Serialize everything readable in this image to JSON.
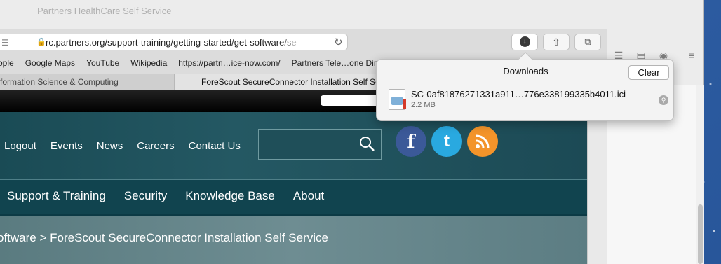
{
  "back_window": {
    "title": "Partners HealthCare Self Service"
  },
  "address_bar": {
    "url": "rc.partners.org/support-training/getting-started/get-software/se"
  },
  "bookmarks": [
    "ople",
    "Google Maps",
    "YouTube",
    "Wikipedia",
    "https://partn…ice-now.com/",
    "Partners Tele…one Direct"
  ],
  "tabs": [
    {
      "label": "formation Science & Computing"
    },
    {
      "label": "ForeScout SecureConnector Installation Self Se"
    }
  ],
  "header_nav": [
    "Logout",
    "Events",
    "News",
    "Careers",
    "Contact Us"
  ],
  "main_nav": [
    "Support & Training",
    "Security",
    "Knowledge Base",
    "About"
  ],
  "breadcrumb": "oftware > ForeScout SecureConnector Installation Self Service",
  "social": {
    "facebook": "f",
    "twitter": "t"
  },
  "downloads": {
    "title": "Downloads",
    "clear_label": "Clear",
    "file_name": "SC-0af81876271331a911…776e338199335b4011.ici",
    "file_size": "2.2 MB"
  }
}
